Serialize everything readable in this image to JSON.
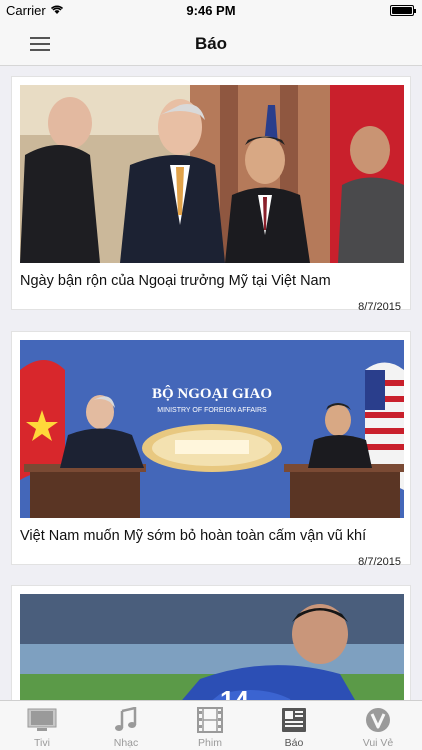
{
  "status_bar": {
    "carrier": "Carrier",
    "time": "9:46 PM"
  },
  "nav": {
    "title": "Báo",
    "menu_icon": "hamburger-menu-icon"
  },
  "articles": [
    {
      "title": "Ngày bận rộn của Ngoại trưởng Mỹ tại Việt Nam",
      "date": "8/7/2015"
    },
    {
      "title": "Việt Nam muốn Mỹ sớm bỏ hoàn toàn cấm vận vũ khí",
      "date": "8/7/2015",
      "image_text": {
        "title": "BỘ NGOẠI GIAO",
        "subtitle": "MINISTRY OF FOREIGN AFFAIRS"
      }
    },
    {
      "image_text": {
        "jersey": "14"
      }
    }
  ],
  "tabs": [
    {
      "label": "Tivi",
      "icon": "tv-icon"
    },
    {
      "label": "Nhạc",
      "icon": "music-note-icon"
    },
    {
      "label": "Phim",
      "icon": "film-strip-icon"
    },
    {
      "label": "Báo",
      "icon": "newspaper-icon",
      "active": true
    },
    {
      "label": "Vui Vẻ",
      "icon": "v-logo-icon"
    }
  ],
  "colors": {
    "active_tab": "#555555",
    "inactive_tab": "#9a9a9a",
    "nav_background": "#f7f7f7"
  }
}
